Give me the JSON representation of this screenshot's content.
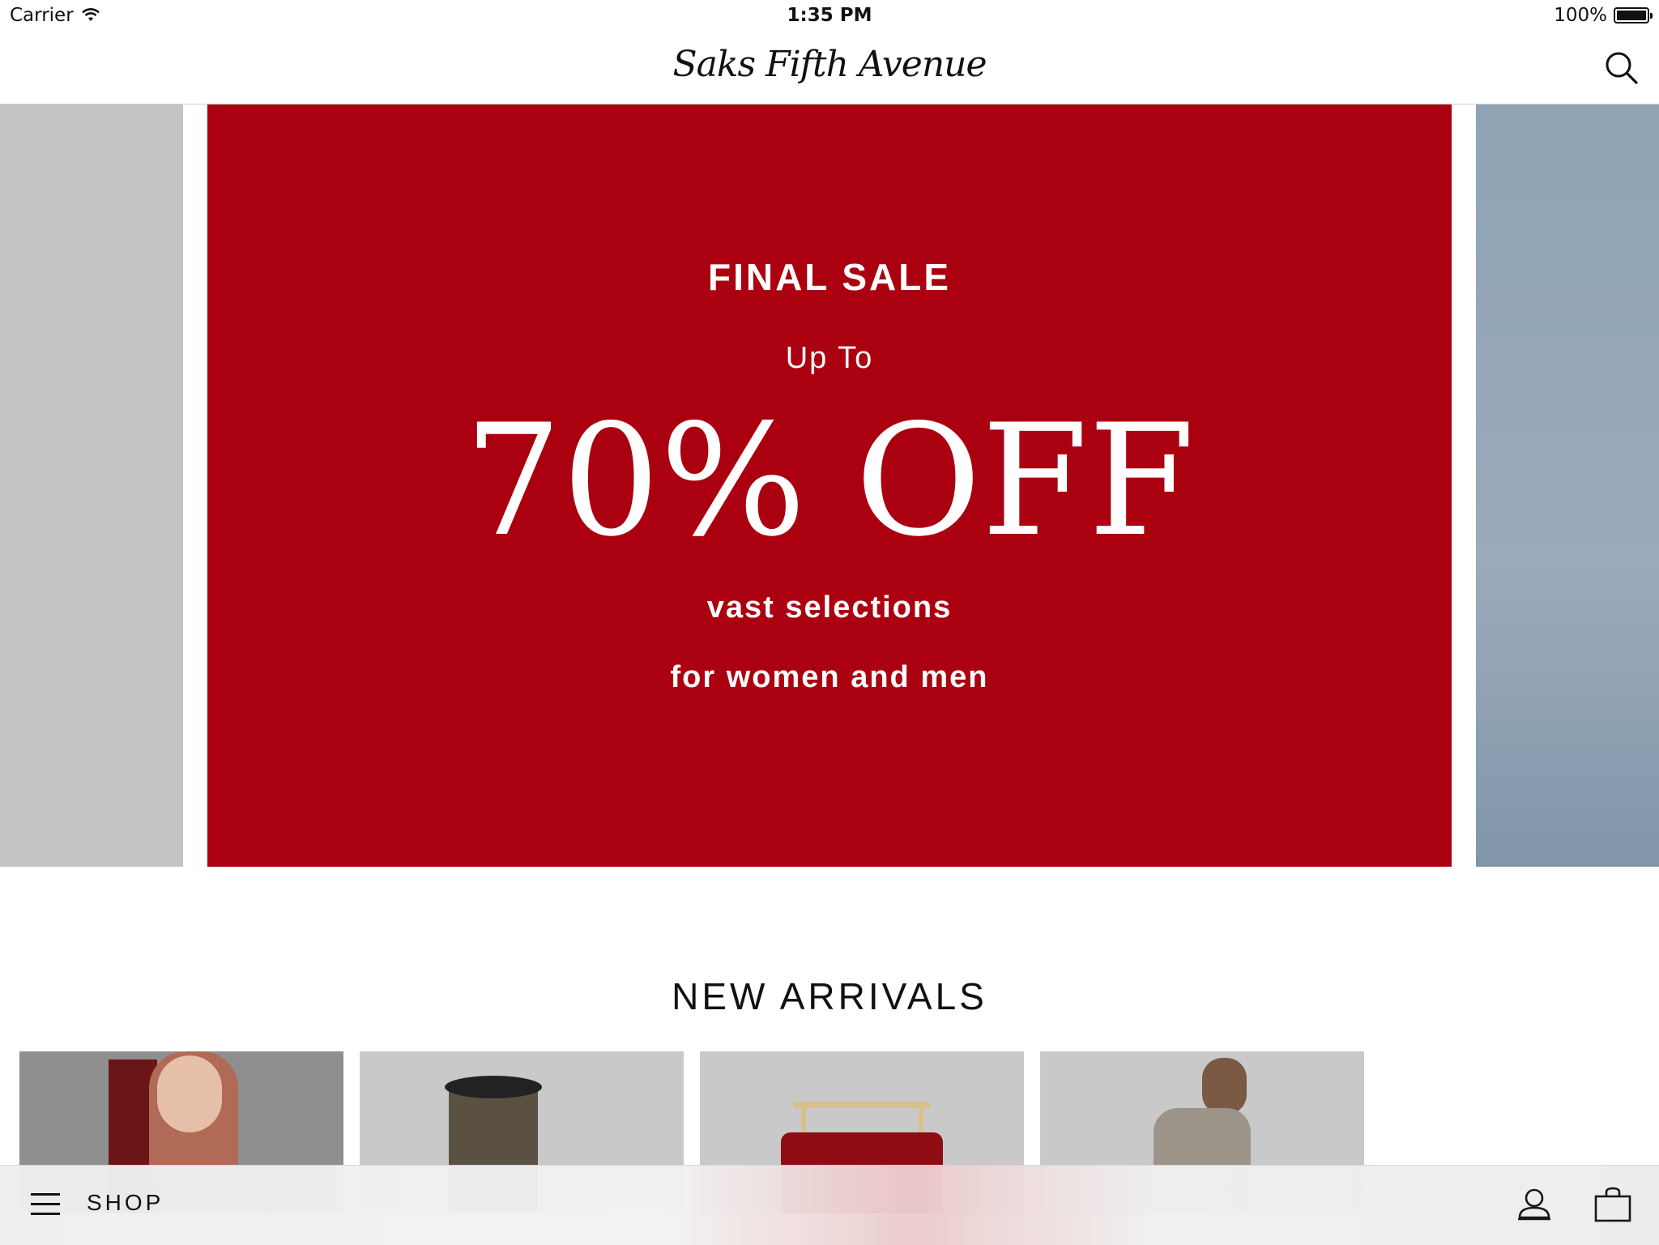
{
  "status_bar": {
    "carrier": "Carrier",
    "time": "1:35 PM",
    "battery": "100%",
    "battery_level": 1.0
  },
  "header": {
    "logo_text": "Saks Fifth Avenue",
    "search_icon": "search-icon"
  },
  "promo": {
    "eyebrow": "FINAL SALE",
    "sub": "Up To",
    "headline": "70% OFF",
    "line1": "vast selections",
    "line2": "for women and men",
    "background_color": "#ab0010"
  },
  "new_arrivals": {
    "title": "NEW ARRIVALS"
  },
  "tab_bar": {
    "menu_icon": "hamburger-icon",
    "shop_label": "SHOP",
    "account_icon": "account-icon",
    "bag_icon": "shopping-bag-icon"
  }
}
